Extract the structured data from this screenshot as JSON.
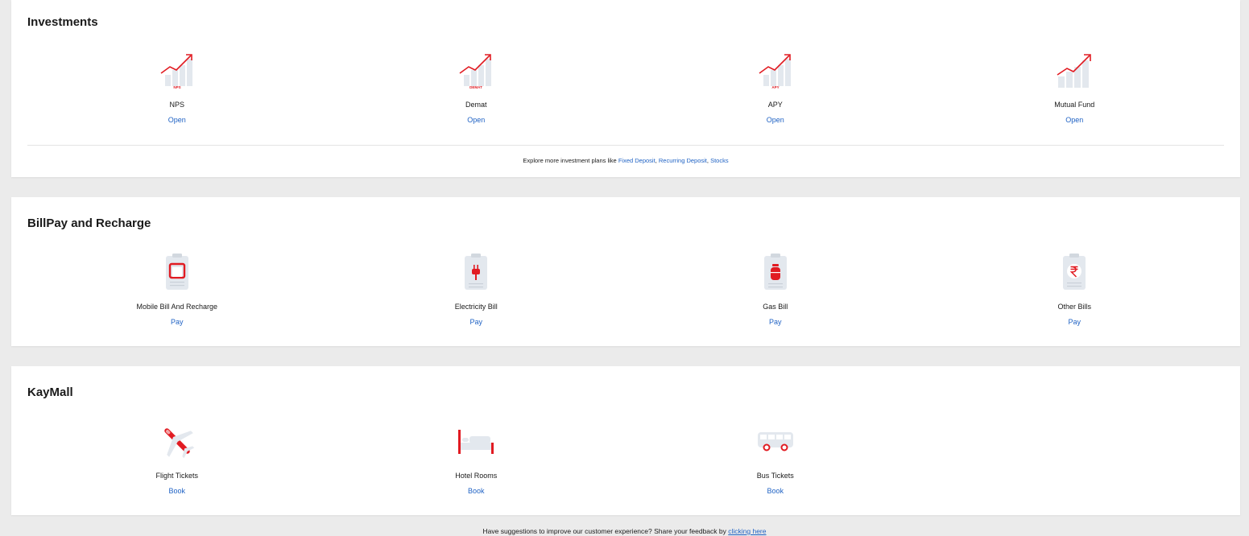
{
  "colors": {
    "accent_red": "#e11b22",
    "link_blue": "#1f62c4",
    "icon_grey": "#e3e8ee"
  },
  "investments": {
    "title": "Investments",
    "items": [
      {
        "label": "NPS",
        "action": "Open",
        "icon": "nps-chart-icon",
        "icon_text": "NPS"
      },
      {
        "label": "Demat",
        "action": "Open",
        "icon": "demat-chart-icon",
        "icon_text": "DEMAT"
      },
      {
        "label": "APY",
        "action": "Open",
        "icon": "apy-chart-icon",
        "icon_text": "APY"
      },
      {
        "label": "Mutual Fund",
        "action": "Open",
        "icon": "mutual-fund-chart-icon",
        "icon_text": ""
      }
    ],
    "explore_prefix": "Explore more investment plans like",
    "explore_links": [
      "Fixed Deposit",
      "Recurring Deposit",
      "Stocks"
    ]
  },
  "billpay": {
    "title": "BillPay and Recharge",
    "items": [
      {
        "label": "Mobile Bill And Recharge",
        "action": "Pay",
        "icon": "mobile-bill-icon"
      },
      {
        "label": "Electricity Bill",
        "action": "Pay",
        "icon": "electricity-bill-icon"
      },
      {
        "label": "Gas Bill",
        "action": "Pay",
        "icon": "gas-bill-icon"
      },
      {
        "label": "Other Bills",
        "action": "Pay",
        "icon": "other-bills-rupee-icon"
      }
    ]
  },
  "kaymall": {
    "title": "KayMall",
    "items": [
      {
        "label": "Flight Tickets",
        "action": "Book",
        "icon": "airplane-icon"
      },
      {
        "label": "Hotel Rooms",
        "action": "Book",
        "icon": "bed-icon"
      },
      {
        "label": "Bus Tickets",
        "action": "Book",
        "icon": "bus-icon"
      }
    ]
  },
  "footer": {
    "feedback_text": "Have suggestions to improve our customer experience? Share your feedback by",
    "feedback_link": "clicking here"
  }
}
